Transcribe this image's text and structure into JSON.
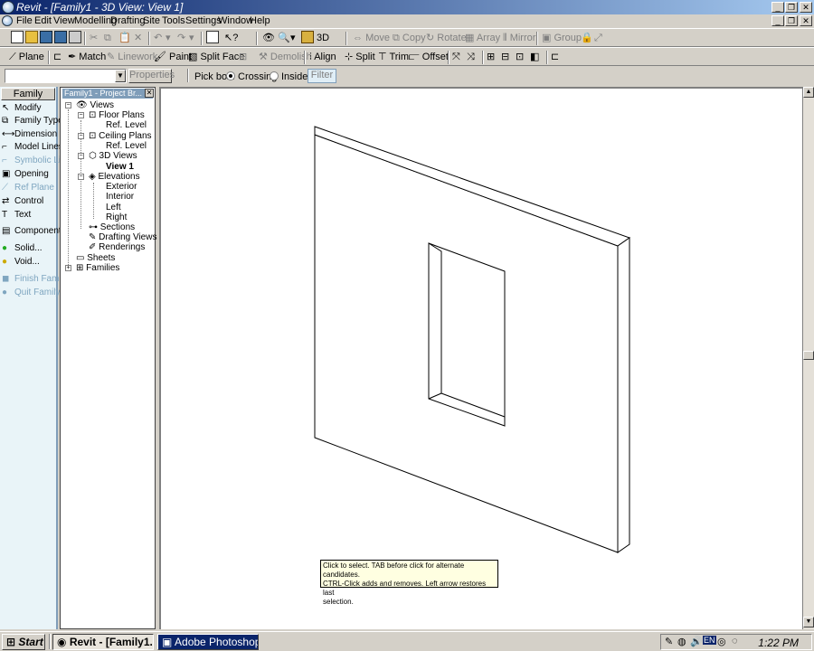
{
  "window": {
    "title": "Revit - [Family1 - 3D View: View 1]"
  },
  "menu": [
    "File",
    "Edit",
    "View",
    "Modelling",
    "Drafting",
    "Site",
    "Tools",
    "Settings",
    "Window",
    "Help"
  ],
  "toolbar1": {
    "zoom_label": "3D",
    "move": "Move",
    "copy": "Copy",
    "rotate": "Rotate",
    "array": "Array",
    "mirror": "Mirror",
    "group": "Group"
  },
  "toolbar2": {
    "plane": "Plane",
    "match": "Match",
    "linework": "Linework",
    "paint": "Paint",
    "split_face": "Split Face",
    "demolish": "Demolish",
    "align": "Align",
    "split": "Split",
    "trim": "Trim",
    "offset": "Offset"
  },
  "options_bar": {
    "type_selector_value": "",
    "properties": "Properties",
    "pick_box_label": "Pick box:",
    "crossing": "Crossing",
    "inside": "Inside",
    "filter": "Filter"
  },
  "design_bar": {
    "tab": "Family",
    "items": [
      {
        "label": "Modify",
        "icon": "arrow-cursor-icon",
        "enabled": true
      },
      {
        "label": "Family Types",
        "icon": "family-types-icon",
        "enabled": true
      },
      {
        "label": "Dimension",
        "icon": "dimension-icon",
        "enabled": true
      },
      {
        "label": "Model Lines",
        "icon": "model-lines-icon",
        "enabled": true
      },
      {
        "label": "Symbolic Line",
        "icon": "symbolic-line-icon",
        "enabled": false
      },
      {
        "label": "Opening",
        "icon": "opening-icon",
        "enabled": true
      },
      {
        "label": "Ref Plane",
        "icon": "ref-plane-icon",
        "enabled": false
      },
      {
        "label": "Control",
        "icon": "control-arrows-icon",
        "enabled": true
      },
      {
        "label": "Text",
        "icon": "text-icon",
        "enabled": true
      },
      {
        "label": "Component",
        "icon": "component-icon",
        "enabled": true
      },
      {
        "label": "Solid...",
        "icon": "solid-icon",
        "enabled": true
      },
      {
        "label": "Void...",
        "icon": "void-icon",
        "enabled": true
      },
      {
        "label": "Finish Family",
        "icon": "finish-family-icon",
        "enabled": false
      },
      {
        "label": "Quit Family",
        "icon": "quit-family-icon",
        "enabled": false
      }
    ]
  },
  "project_browser": {
    "title": "Family1 - Project Br...",
    "views": "Views",
    "floor_plans": "Floor Plans",
    "floor_ref_level": "Ref. Level",
    "ceiling_plans": "Ceiling Plans",
    "ceiling_ref_level": "Ref. Level",
    "views_3d": "3D Views",
    "view_1": "View 1",
    "elevations": "Elevations",
    "exterior": "Exterior",
    "interior": "Interior",
    "left": "Left",
    "right": "Right",
    "sections": "Sections",
    "drafting_views": "Drafting Views",
    "renderings": "Renderings",
    "sheets": "Sheets",
    "families": "Families"
  },
  "tooltip": {
    "line1": "Click to select. TAB before click for alternate candidates.",
    "line2": "CTRL-Click adds and removes. Left arrow restores last",
    "line3": "selection."
  },
  "taskbar": {
    "start": "Start",
    "revit_task": "Revit - [Family1...",
    "photoshop_task": "Adobe Photoshop",
    "lang": "EN",
    "clock": "1:22 PM"
  }
}
